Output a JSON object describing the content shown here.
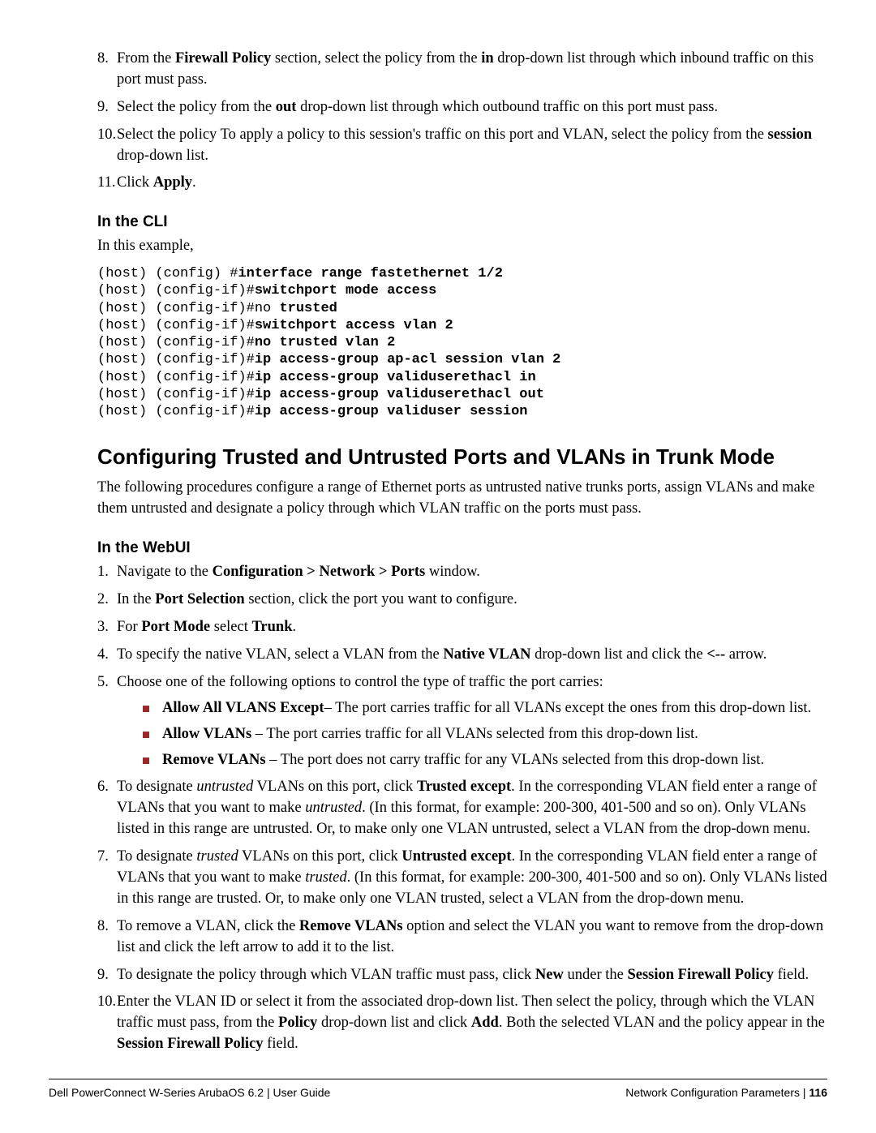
{
  "steps_top": [
    {
      "num": "8.",
      "html": "From the <span class='b'>Firewall Policy</span> section, select the policy from the <span class='b'>in</span> drop-down list through which inbound traffic on this port must pass."
    },
    {
      "num": "9.",
      "html": "Select the policy from the <span class='b'>out</span> drop-down list through which outbound traffic on this port must pass."
    },
    {
      "num": "10.",
      "html": "Select the policy To apply a policy to this session's traffic on this port and VLAN, select the policy from the <span class='b'>session</span> drop-down list."
    },
    {
      "num": "11.",
      "html": "Click <span class='b'>Apply</span>."
    }
  ],
  "cli_heading": "In the CLI",
  "cli_intro": "In this example,",
  "cli_lines": [
    {
      "prefix": "(host) (config) #",
      "cmd": "interface range fastethernet 1/2"
    },
    {
      "prefix": "(host) (config-if)#",
      "cmd": "switchport mode access"
    },
    {
      "prefix": "(host) (config-if)#no ",
      "cmd": "trusted"
    },
    {
      "prefix": "(host) (config-if)#",
      "cmd": "switchport access vlan 2"
    },
    {
      "prefix": "(host) (config-if)#",
      "cmd": "no trusted vlan 2"
    },
    {
      "prefix": "(host) (config-if)#",
      "cmd": "ip access-group ap-acl session vlan 2"
    },
    {
      "prefix": "(host) (config-if)#",
      "cmd": "ip access-group validuserethacl in"
    },
    {
      "prefix": "(host) (config-if)#",
      "cmd": "ip access-group validuserethacl out"
    },
    {
      "prefix": "(host) (config-if)#",
      "cmd": "ip access-group validuser session"
    }
  ],
  "section_title": "Configuring Trusted and Untrusted Ports and VLANs in Trunk Mode",
  "section_intro": "The following procedures configure a range of Ethernet ports as untrusted native trunks ports, assign VLANs and make them untrusted and designate a policy through which VLAN traffic on the ports must pass.",
  "webui_heading": "In the WebUI",
  "steps_webui": [
    {
      "num": "1.",
      "html": "Navigate to the <span class='b'>Configuration &gt; Network &gt; Ports</span> window."
    },
    {
      "num": "2.",
      "html": "In the <span class='b'>Port Selection</span> section, click the port you want to configure."
    },
    {
      "num": "3.",
      "html": "For <span class='b'>Port Mode</span> select <span class='b'>Trunk</span>."
    },
    {
      "num": "4.",
      "html": "To specify the native VLAN, select a VLAN from the <span class='b'>Native VLAN</span> drop-down list and click the <span class='b'>&lt;--</span> arrow."
    },
    {
      "num": "5.",
      "html": "Choose one of the following options to control the type of traffic the port carries:"
    },
    {
      "num": "6.",
      "html": "To designate <span class='i'>untrusted</span> VLANs on this port, click <span class='b'>Trusted except</span>. In the corresponding VLAN field enter a range of VLANs that you want to make <span class='i'>untrusted</span>. (In this format, for example: 200-300, 401-500 and so on). Only VLANs listed in this range are untrusted. Or, to make only one VLAN untrusted, select a VLAN from the drop-down menu."
    },
    {
      "num": "7.",
      "html": "To designate <span class='i'>trusted</span> VLANs on this port, click <span class='b'>Untrusted except</span>. In the corresponding VLAN field enter a range of VLANs that you want to make <span class='i'>trusted</span>. (In this format, for example: 200-300, 401-500 and so on). Only VLANs listed in this range are trusted. Or, to make only one VLAN trusted, select a VLAN from the drop-down menu."
    },
    {
      "num": "8.",
      "html": "To remove a VLAN, click the <span class='b'>Remove VLANs</span> option and select the VLAN you want to remove from the drop-down list and click the left arrow to add it to the list."
    },
    {
      "num": "9.",
      "html": "To designate the policy through which VLAN traffic must pass, click <span class='b'>New</span> under the <span class='b'>Session Firewall Policy</span> field."
    },
    {
      "num": "10.",
      "html": "Enter the VLAN ID or select it from the associated drop-down list. Then select the policy, through which the VLAN traffic must pass, from the <span class='b'>Policy</span> drop-down list and click <span class='b'>Add</span>. Both the selected VLAN and the policy appear in the <span class='b'>Session Firewall Policy</span> field."
    }
  ],
  "bullets5": [
    "<span class='b'>Allow All VLANS Except</span>– The port carries traffic for all VLANs except the ones from this drop-down list.",
    "<span class='b'>Allow VLANs</span> – The port carries traffic for all VLANs selected from this drop-down list.",
    "<span class='b'>Remove VLANs</span> – The port does not carry traffic for any VLANs selected from this drop-down list."
  ],
  "footer_left": "Dell PowerConnect W-Series ArubaOS 6.2 | User Guide",
  "footer_right_label": "Network Configuration Parameters",
  "footer_sep": " | ",
  "footer_page": "116"
}
